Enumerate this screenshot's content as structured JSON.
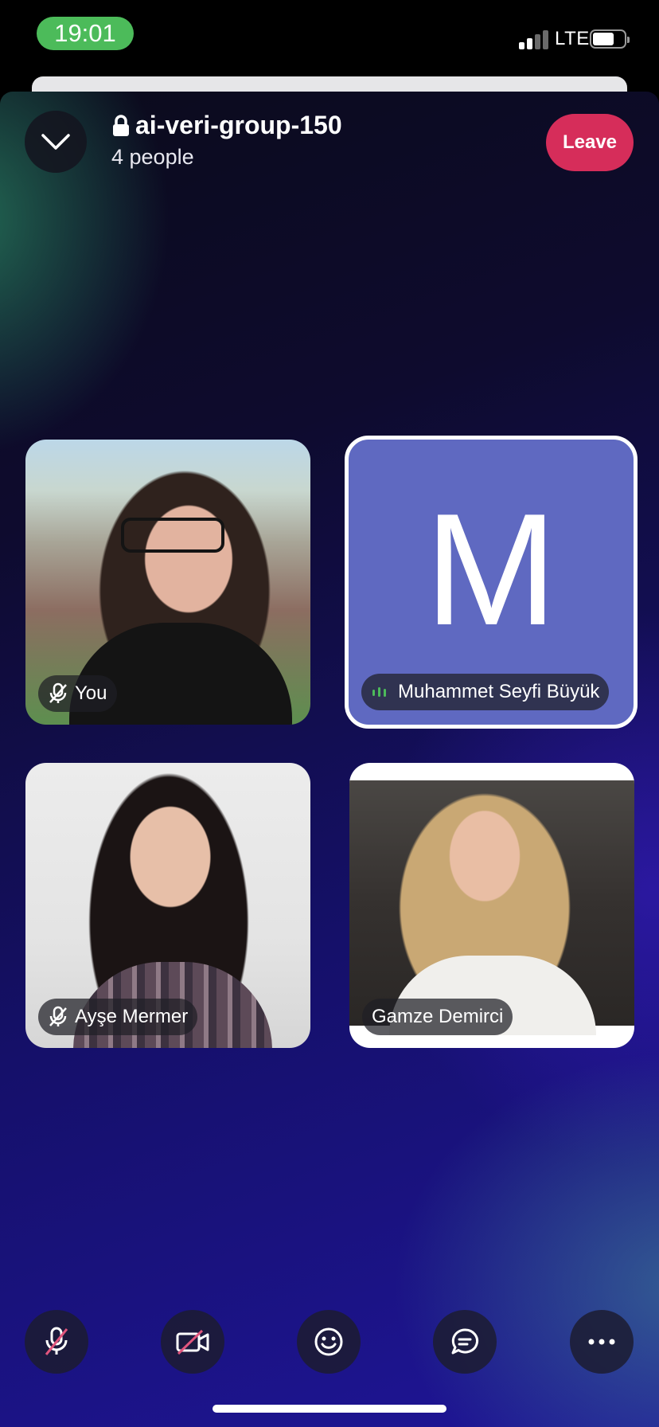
{
  "status_bar": {
    "time": "19:01",
    "network": "LTE"
  },
  "header": {
    "room_name": "ai-veri-group-150",
    "people_count": "4 people",
    "leave_label": "Leave",
    "icons": [
      "chevron-down-icon",
      "lock-icon"
    ]
  },
  "participants": [
    {
      "name": "You",
      "muted": true,
      "speaking": false,
      "avatar": "photo"
    },
    {
      "name": "Muhammet Seyfi Büyük",
      "initial": "M",
      "muted": false,
      "speaking": true,
      "avatar": "letter",
      "avatar_color": "#5f69c1"
    },
    {
      "name": "Ayşe Mermer",
      "muted": true,
      "speaking": false,
      "avatar": "photo"
    },
    {
      "name": "Gamze Demirci",
      "muted": false,
      "speaking": false,
      "avatar": "photo"
    }
  ],
  "toolbar": {
    "buttons": [
      "mic-off-icon",
      "camera-off-icon",
      "emoji-icon",
      "chat-icon",
      "more-icon"
    ]
  },
  "colors": {
    "leave": "#d62d5a",
    "time_pill": "#4cbb5a",
    "speaking_indicator": "#4cbb5a",
    "mute_slash": "#e0557d"
  }
}
